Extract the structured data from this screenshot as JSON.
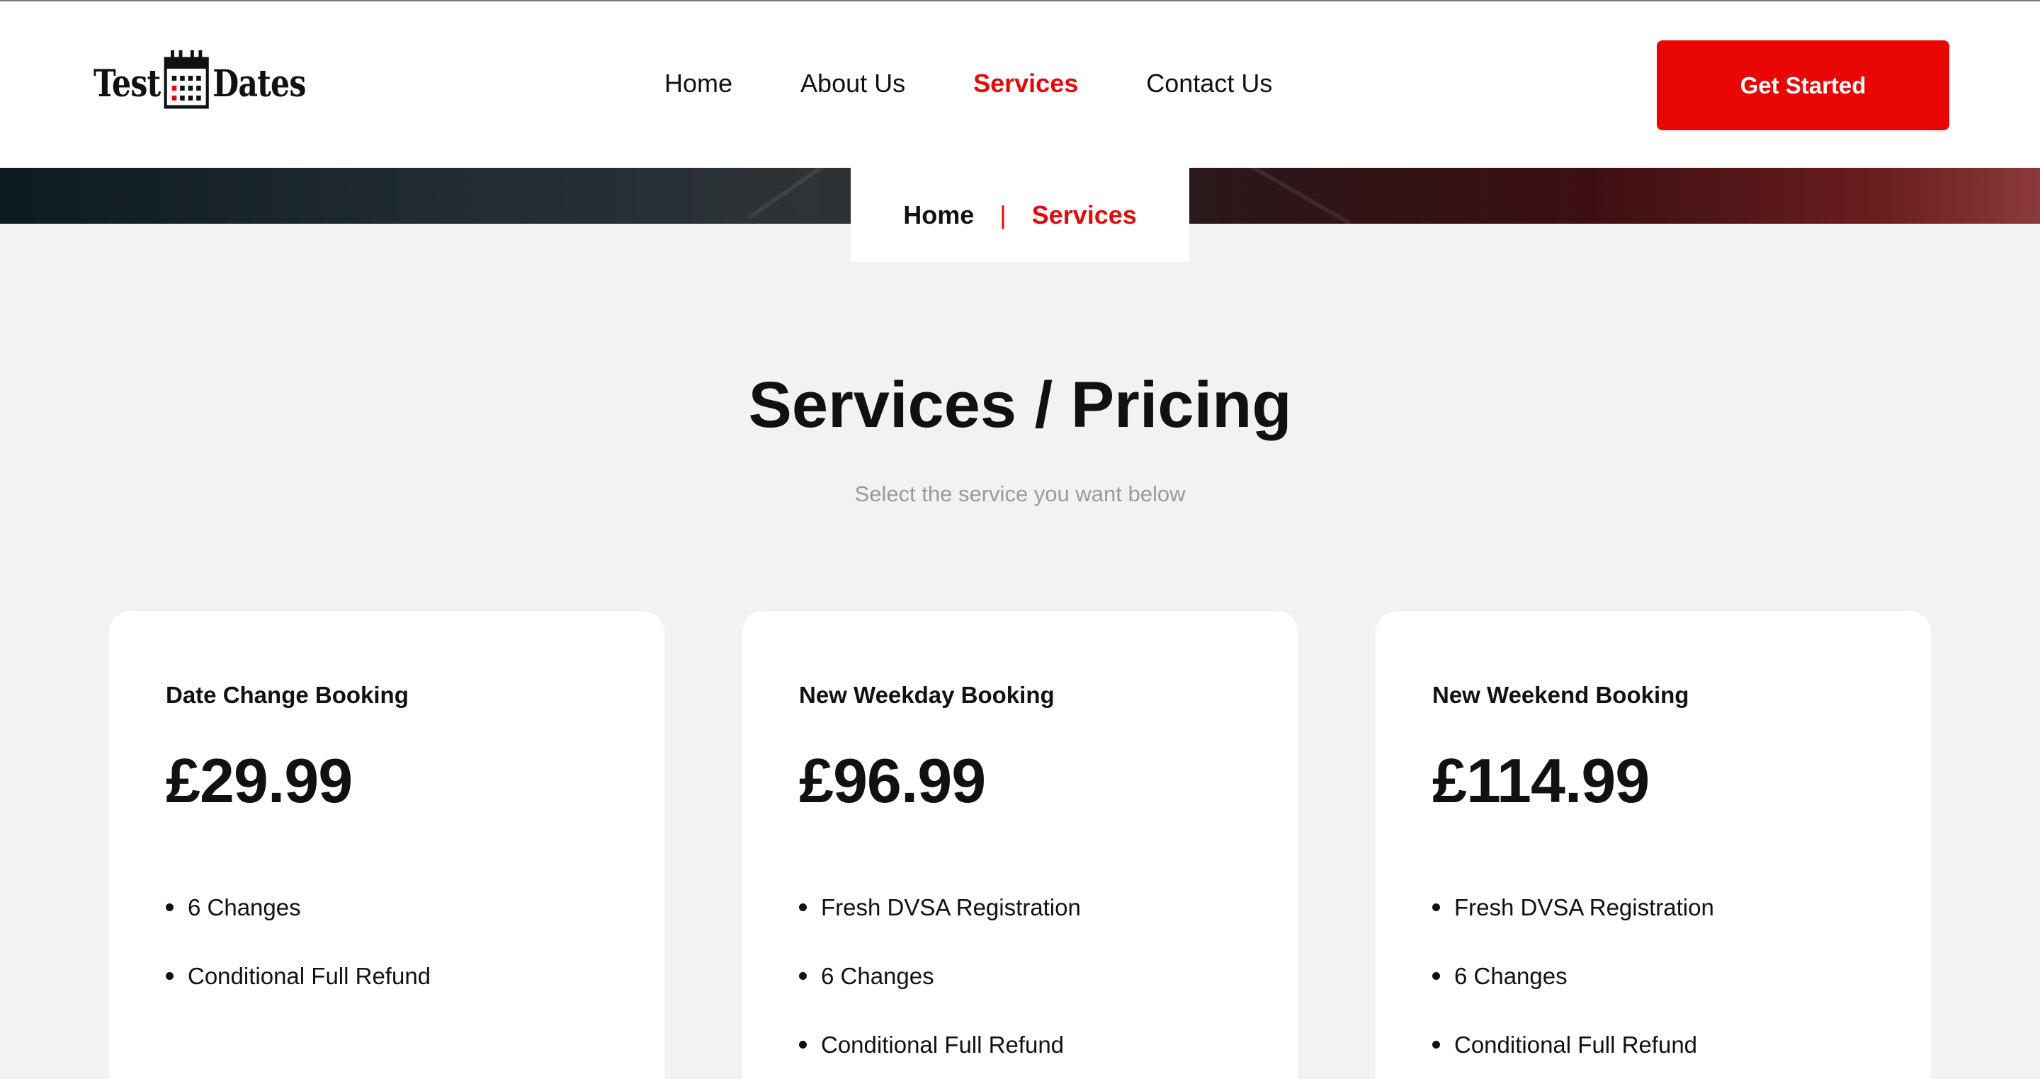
{
  "header": {
    "logo_left": "Test",
    "logo_right": "Dates",
    "nav": [
      {
        "label": "Home"
      },
      {
        "label": "About Us"
      },
      {
        "label": "Services"
      },
      {
        "label": "Contact Us"
      }
    ],
    "active_nav": "Services",
    "cta_label": "Get Started"
  },
  "breadcrumb": {
    "home": "Home",
    "separator": "|",
    "current": "Services"
  },
  "section": {
    "title": "Services / Pricing",
    "subtitle": "Select the service you want below"
  },
  "cards": [
    {
      "name": "Date Change Booking",
      "price": "£29.99",
      "features": [
        "6 Changes",
        "Conditional Full Refund"
      ]
    },
    {
      "name": "New Weekday Booking",
      "price": "£96.99",
      "features": [
        "Fresh DVSA Registration",
        "6 Changes",
        "Conditional Full Refund"
      ]
    },
    {
      "name": "New Weekend Booking",
      "price": "£114.99",
      "features": [
        "Fresh DVSA Registration",
        "6 Changes",
        "Conditional Full Refund"
      ]
    }
  ],
  "colors": {
    "accent": "#e20a0a",
    "button": "#ea0505",
    "background": "#f2f2f2",
    "card": "#ffffff"
  },
  "icons": [
    "calendar-icon"
  ]
}
